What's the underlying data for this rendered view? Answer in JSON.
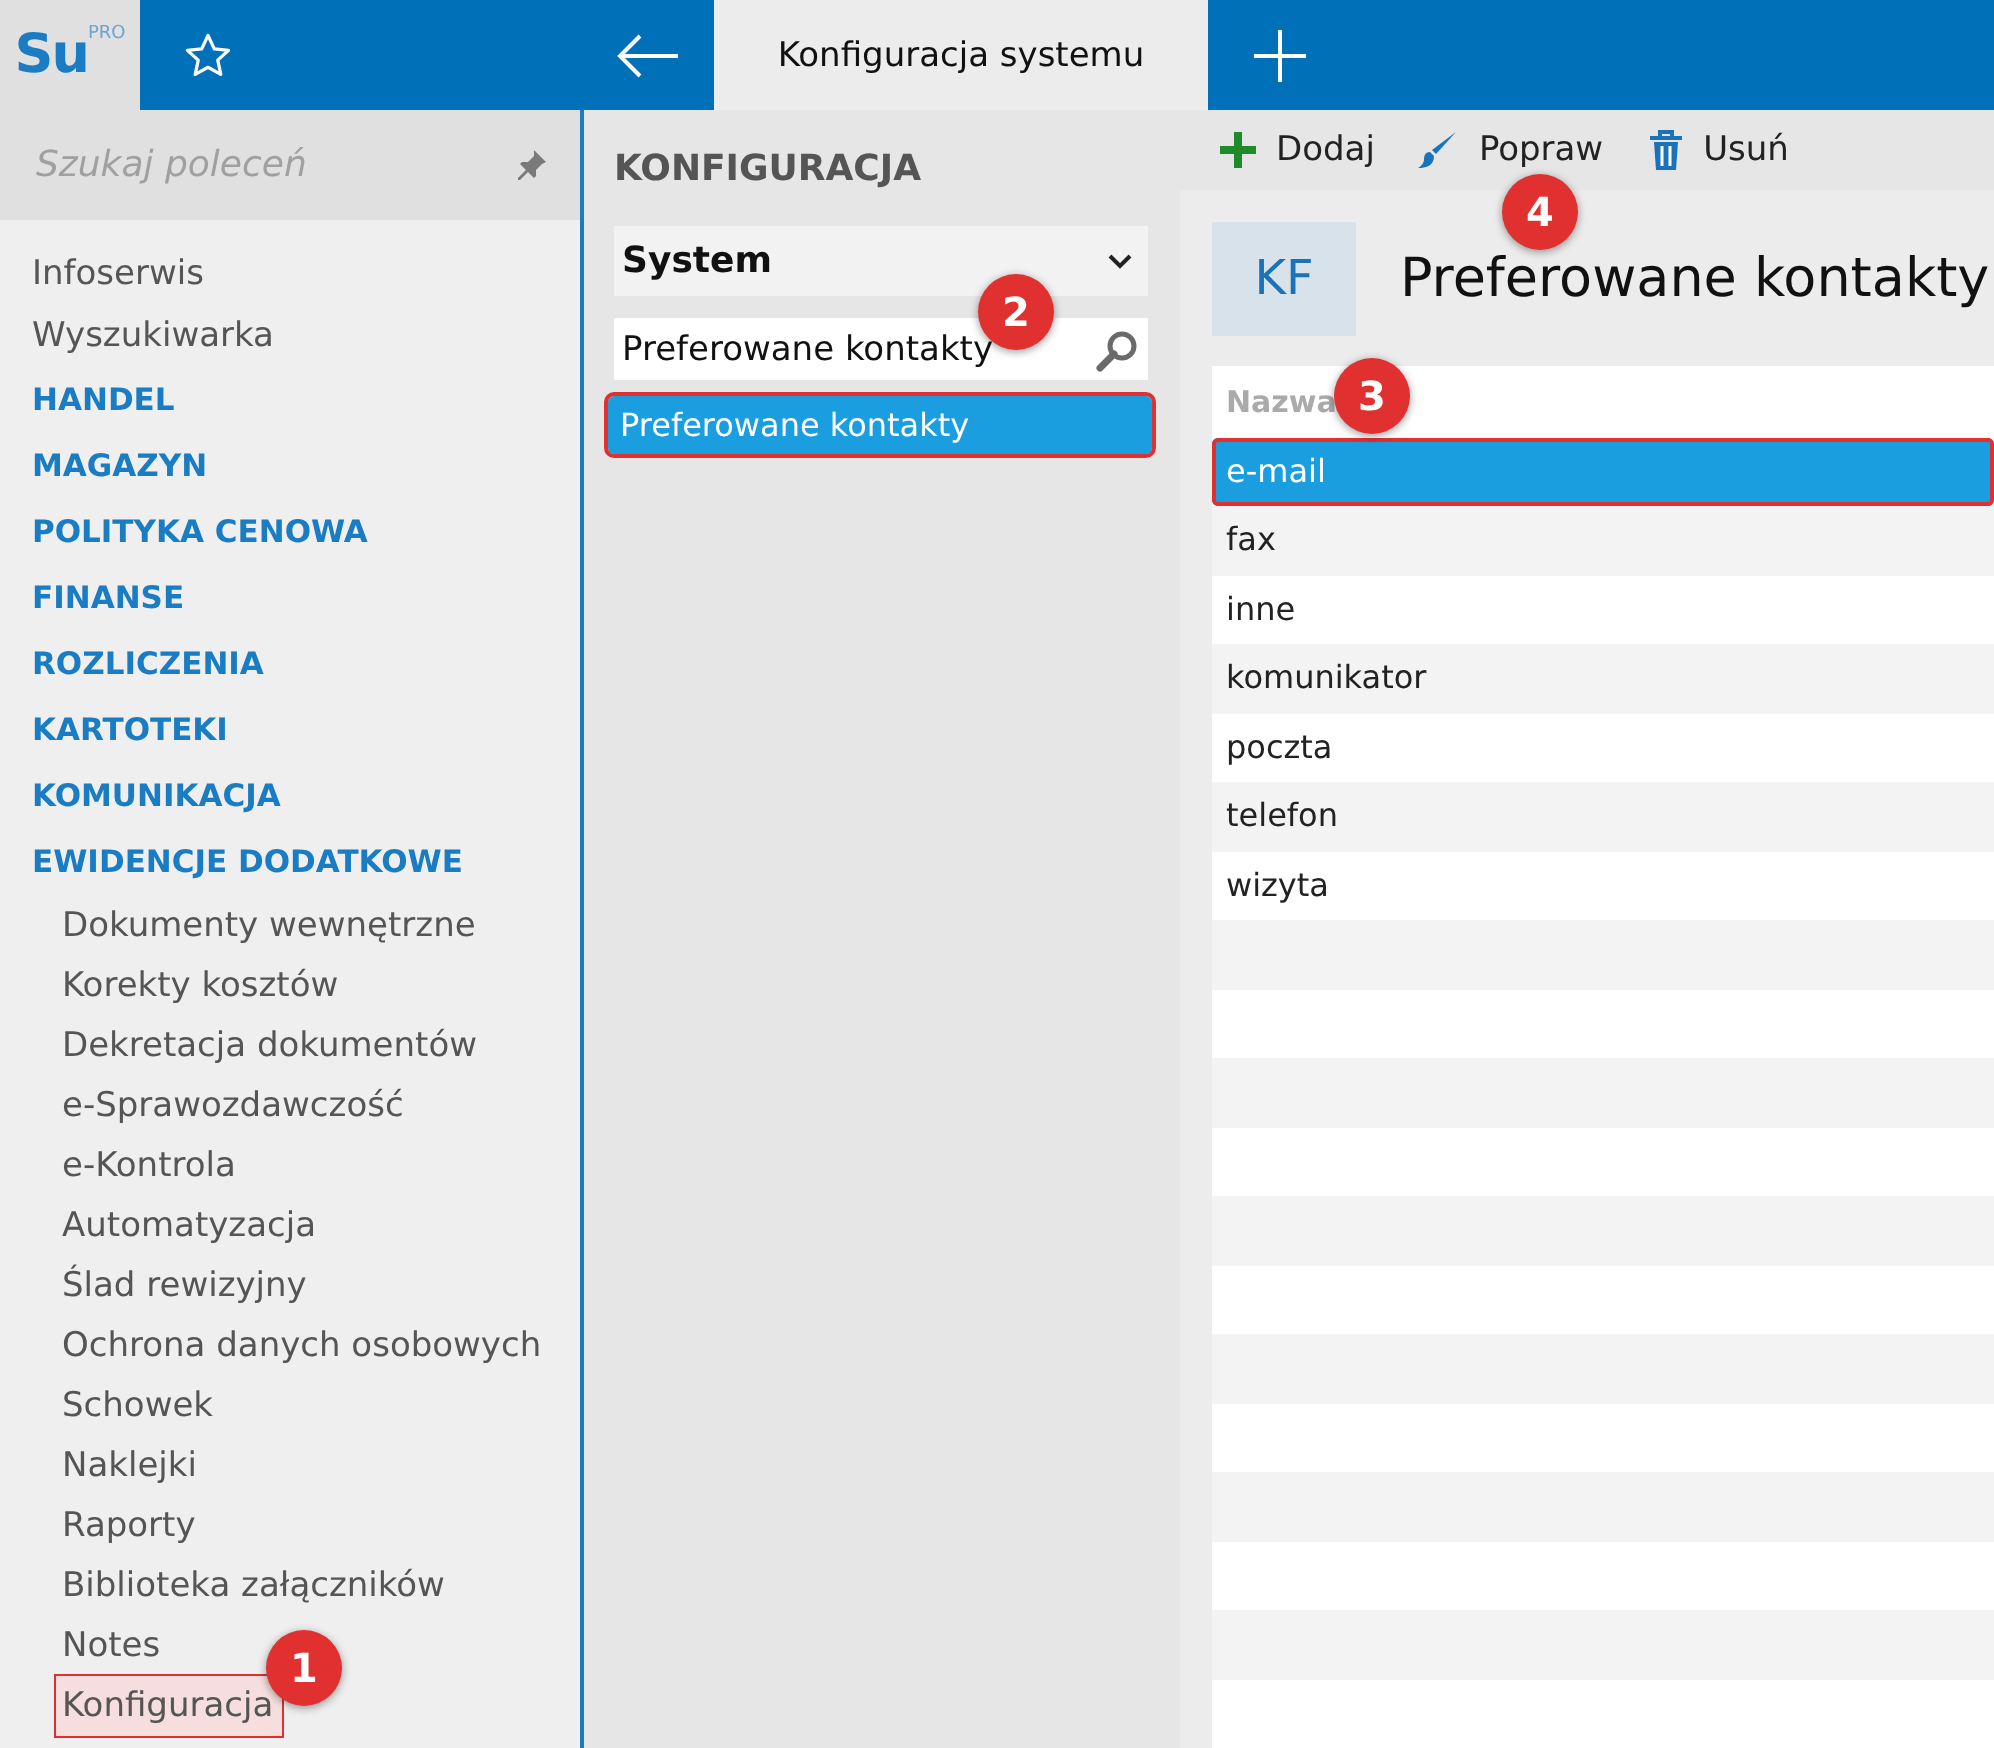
{
  "topbar": {
    "logo": "Su",
    "logo_sup": "PRO",
    "tab": {
      "label": "Konfiguracja systemu",
      "selected": true
    }
  },
  "sidebar": {
    "search": {
      "placeholder": "Szukaj poleceń"
    },
    "items": [
      {
        "label": "Infoserwis",
        "kind": "link",
        "selected": false
      },
      {
        "label": "Wyszukiwarka",
        "kind": "link",
        "selected": false
      },
      {
        "label": "HANDEL",
        "kind": "section",
        "selected": false
      },
      {
        "label": "MAGAZYN",
        "kind": "section",
        "selected": false
      },
      {
        "label": "POLITYKA CENOWA",
        "kind": "section",
        "selected": false
      },
      {
        "label": "FINANSE",
        "kind": "section",
        "selected": false
      },
      {
        "label": "ROZLICZENIA",
        "kind": "section",
        "selected": false
      },
      {
        "label": "KARTOTEKI",
        "kind": "section",
        "selected": false
      },
      {
        "label": "KOMUNIKACJA",
        "kind": "section",
        "selected": false
      },
      {
        "label": "EWIDENCJE DODATKOWE",
        "kind": "section",
        "selected": false,
        "children": [
          {
            "label": "Dokumenty wewnętrzne",
            "selected": false
          },
          {
            "label": "Korekty kosztów",
            "selected": false
          },
          {
            "label": "Dekretacja dokumentów",
            "selected": false
          },
          {
            "label": "e-Sprawozdawczość",
            "selected": false
          },
          {
            "label": "e-Kontrola",
            "selected": false
          },
          {
            "label": "Automatyzacja",
            "selected": false
          },
          {
            "label": "Ślad rewizyjny",
            "selected": false
          },
          {
            "label": "Ochrona danych osobowych",
            "selected": false
          },
          {
            "label": "Schowek",
            "selected": false
          },
          {
            "label": "Naklejki",
            "selected": false
          },
          {
            "label": "Raporty",
            "selected": false
          },
          {
            "label": "Biblioteka załączników",
            "selected": false
          },
          {
            "label": "Notes",
            "selected": false
          },
          {
            "label": "Konfiguracja",
            "selected": true
          }
        ]
      }
    ]
  },
  "middle": {
    "title": "KONFIGURACJA",
    "dropdown": "System",
    "search": {
      "value": "Preferowane kontakty"
    },
    "results": [
      {
        "label": "Preferowane kontakty",
        "selected": true
      }
    ]
  },
  "toolbar": [
    {
      "label": "Dodaj",
      "kind": "add"
    },
    {
      "label": "Popraw",
      "kind": "edit"
    },
    {
      "label": "Usuń",
      "kind": "delete"
    }
  ],
  "panel": {
    "initials": "KF",
    "title": "Preferowane kontakty",
    "table": {
      "columns": [
        "Nazwa"
      ],
      "rows": [
        {
          "name": "e-mail",
          "selected": true
        },
        {
          "name": "fax",
          "selected": false
        },
        {
          "name": "inne",
          "selected": false
        },
        {
          "name": "komunikator",
          "selected": false
        },
        {
          "name": "poczta",
          "selected": false
        },
        {
          "name": "telefon",
          "selected": false
        },
        {
          "name": "wizyta",
          "selected": false
        }
      ]
    }
  },
  "annotations": [
    "1",
    "2",
    "3",
    "4"
  ]
}
